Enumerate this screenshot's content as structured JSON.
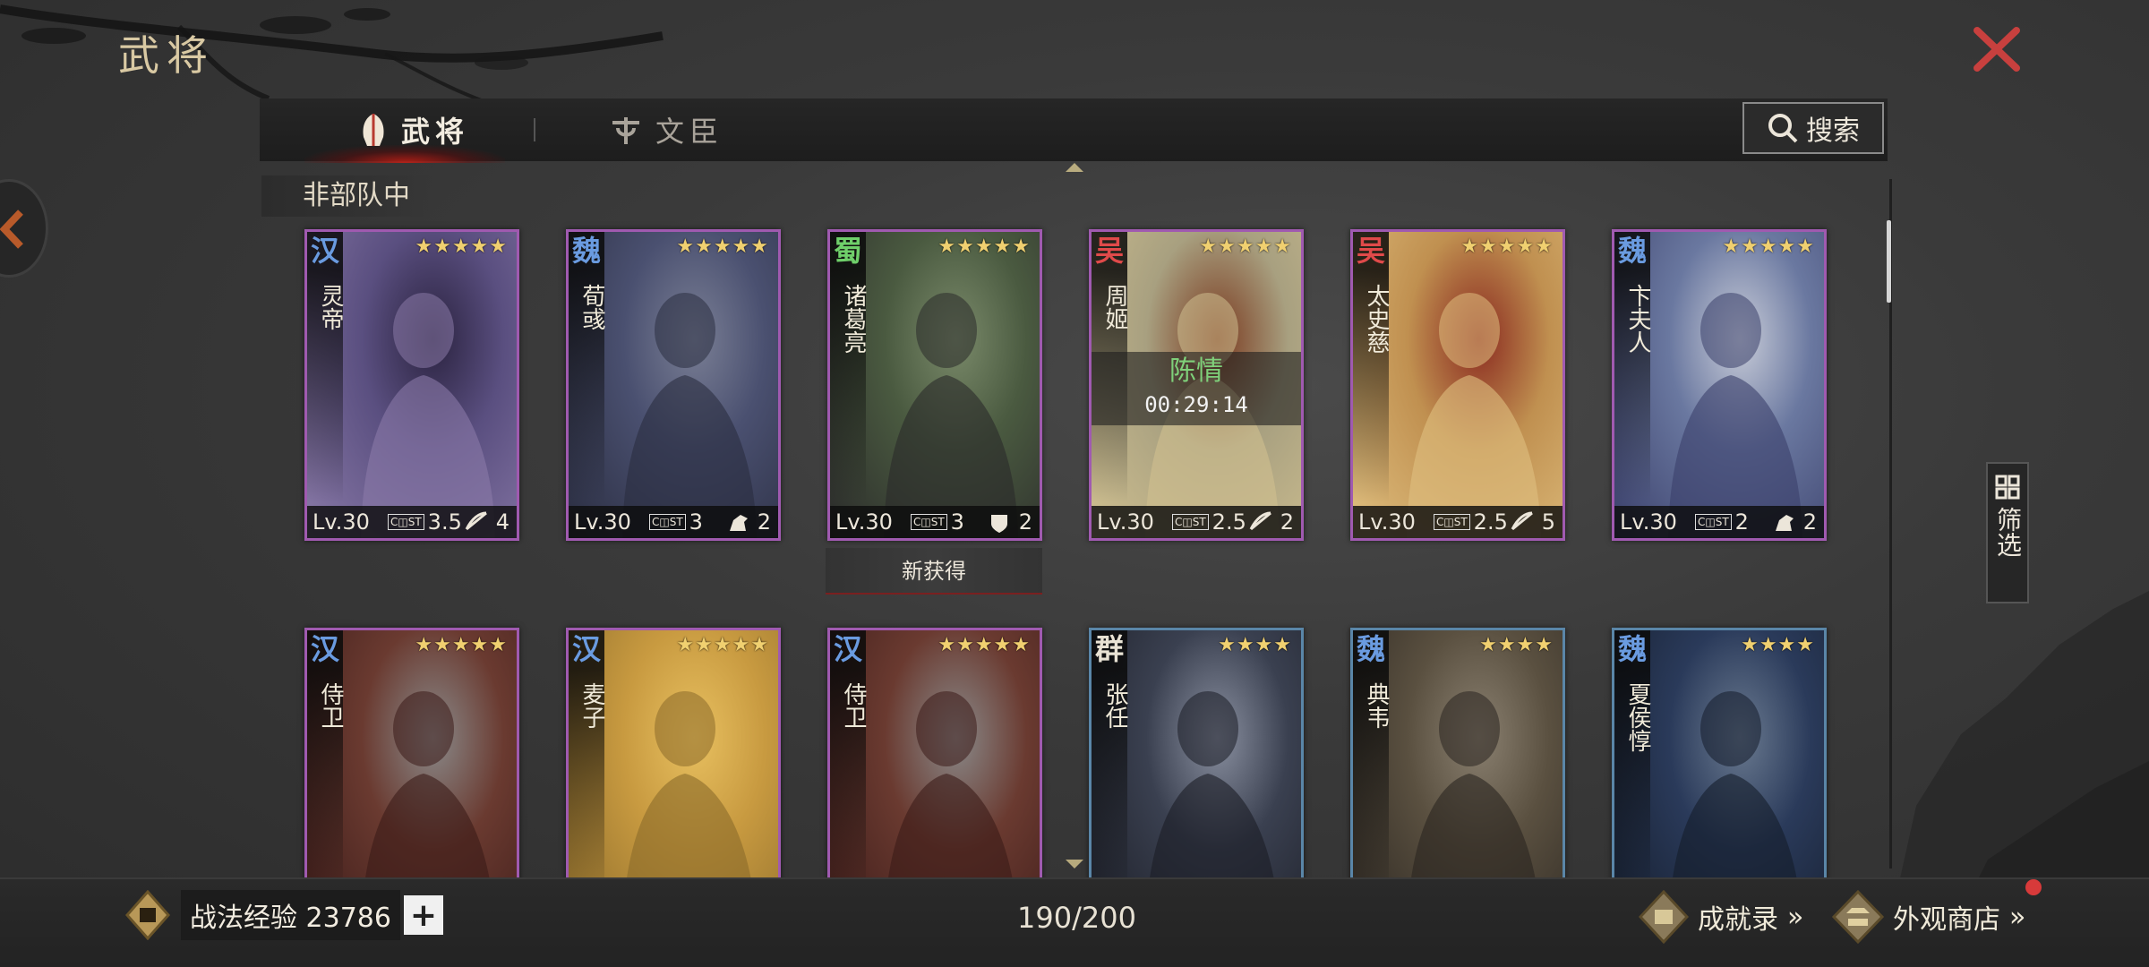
{
  "title": "武将",
  "colors": {
    "accent_red": "#d84545",
    "purple_frame": "#a05ab0",
    "blue_frame": "#5a86a8",
    "star": "#f0d070",
    "status_green": "#7fd07a"
  },
  "tabs": [
    {
      "label": "武将",
      "active": true,
      "icon": "helmet-icon"
    },
    {
      "label": "文臣",
      "active": false,
      "icon": "scholar-icon"
    }
  ],
  "search": {
    "label": "搜索",
    "icon": "search-icon"
  },
  "section": {
    "label": "非部队中"
  },
  "filter": {
    "label": "筛选",
    "icon": "grid-icon"
  },
  "cards": [
    {
      "faction": "汉",
      "faction_color": "#6a9be0",
      "name": "灵帝",
      "stars": "★★★★★",
      "level": "Lv.30",
      "cost": "3.5",
      "troop": "4",
      "troop_icon": "bow-icon",
      "frame": "purple",
      "palette": [
        "#5a4f80",
        "#2b2340",
        "#8a7aa8"
      ]
    },
    {
      "faction": "魏",
      "faction_color": "#6a9be0",
      "name": "荀彧",
      "stars": "★★★★★",
      "level": "Lv.30",
      "cost": "3",
      "troop": "2",
      "troop_icon": "horse-icon",
      "frame": "purple",
      "palette": [
        "#4a5070",
        "#7a7f95",
        "#2a2d40"
      ]
    },
    {
      "faction": "蜀",
      "faction_color": "#6fcf6a",
      "name": "诸葛亮",
      "stars": "★★★★★",
      "level": "Lv.30",
      "cost": "3",
      "troop": "2",
      "troop_icon": "shield-icon",
      "frame": "purple",
      "palette": [
        "#4a5a40",
        "#7a8a6a",
        "#2a2a2a"
      ]
    },
    {
      "faction": "吴",
      "faction_color": "#e04a4a",
      "name": "周姬",
      "stars": "★★★★★",
      "level": "Lv.30",
      "cost": "2.5",
      "troop": "2",
      "troop_icon": "bow-icon",
      "frame": "purple",
      "palette": [
        "#a8a080",
        "#7a3a20",
        "#d0c090"
      ],
      "status": "陈情",
      "timer": "00:29:14"
    },
    {
      "faction": "吴",
      "faction_color": "#e04a4a",
      "name": "太史慈",
      "stars": "★★★★★",
      "level": "Lv.30",
      "cost": "2.5",
      "troop": "5",
      "troop_icon": "bow-icon",
      "frame": "purple",
      "palette": [
        "#c09050",
        "#8a2a20",
        "#e0c080"
      ]
    },
    {
      "faction": "魏",
      "faction_color": "#6a9be0",
      "name": "卞夫人",
      "stars": "★★★★★",
      "level": "Lv.30",
      "cost": "2",
      "troop": "2",
      "troop_icon": "horse-icon",
      "frame": "purple",
      "palette": [
        "#6a78a0",
        "#c8ccd8",
        "#3a3f6a"
      ]
    },
    {
      "faction": "汉",
      "faction_color": "#6a9be0",
      "name": "侍卫",
      "stars": "★★★★★",
      "frame": "purple",
      "palette": [
        "#6a3a30",
        "#8a8a8a",
        "#3a1a18"
      ]
    },
    {
      "faction": "汉",
      "faction_color": "#6a9be0",
      "name": "麦子",
      "stars": "★★★★★",
      "frame": "purple",
      "palette": [
        "#c89a40",
        "#e8c060",
        "#8a6a2a"
      ]
    },
    {
      "faction": "汉",
      "faction_color": "#6a9be0",
      "name": "侍卫",
      "stars": "★★★★★",
      "frame": "purple",
      "palette": [
        "#6a3a30",
        "#8a8a8a",
        "#3a1a18"
      ]
    },
    {
      "faction": "群",
      "faction_color": "#e8e2d4",
      "name": "张任",
      "stars": "★★★★",
      "frame": "blue",
      "palette": [
        "#3a4050",
        "#8a90a0",
        "#1a1c24"
      ]
    },
    {
      "faction": "魏",
      "faction_color": "#6a9be0",
      "name": "典韦",
      "stars": "★★★★",
      "frame": "blue",
      "palette": [
        "#5a5040",
        "#8a8070",
        "#2a2520"
      ]
    },
    {
      "faction": "魏",
      "faction_color": "#6a9be0",
      "name": "夏侯惇",
      "stars": "★★★★",
      "frame": "blue",
      "palette": [
        "#2a3a5a",
        "#6a7a90",
        "#141c2a"
      ]
    }
  ],
  "new_tag": "新获得",
  "bottom": {
    "exp_label": "战法经验 23786",
    "plus": "+",
    "count": "190/200",
    "achievements": "成就录",
    "shop": "外观商店",
    "chevrons": "»"
  }
}
